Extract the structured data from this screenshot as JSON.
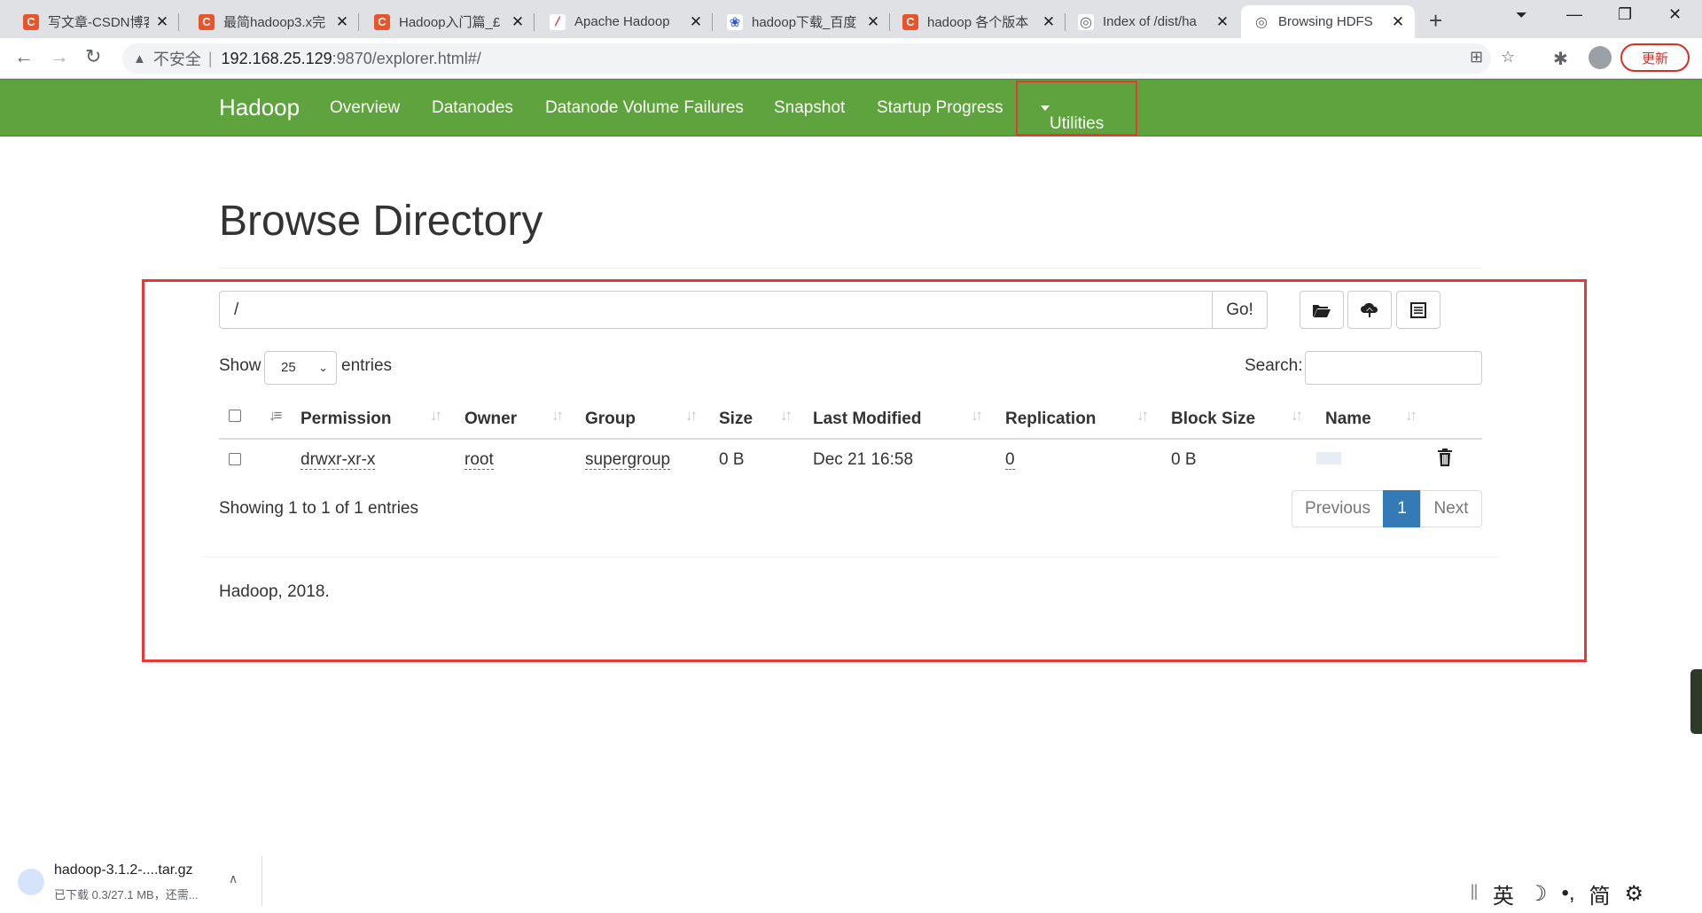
{
  "browser": {
    "tabs": [
      {
        "title": "写文章-CSDN博客",
        "icon": "csdn-icon"
      },
      {
        "title": "最简hadoop3.x完",
        "icon": "csdn-icon"
      },
      {
        "title": "Hadoop入门篇_£",
        "icon": "csdn-icon"
      },
      {
        "title": "Apache Hadoop",
        "icon": "apache-feather-icon"
      },
      {
        "title": "hadoop下载_百度",
        "icon": "baidu-paw-icon"
      },
      {
        "title": "hadoop 各个版本",
        "icon": "csdn-icon"
      },
      {
        "title": "Index of /dist/ha",
        "icon": "globe-icon"
      },
      {
        "title": "Browsing HDFS",
        "icon": "globe-icon"
      }
    ],
    "active_tab": 7,
    "address": {
      "security_label": "不安全",
      "host": "192.168.25.129",
      "path": ":9870/explorer.html#/"
    },
    "update_button": "更新"
  },
  "navbar": {
    "brand": "Hadoop",
    "items": [
      "Overview",
      "Datanodes",
      "Datanode Volume Failures",
      "Snapshot",
      "Startup Progress"
    ],
    "utilities": "Utilities"
  },
  "page": {
    "title": "Browse Directory",
    "path_value": "/",
    "go_label": "Go!",
    "show_label": "Show",
    "page_length": "25",
    "entries_label": "entries",
    "search_label": "Search:",
    "columns": [
      "Permission",
      "Owner",
      "Group",
      "Size",
      "Last Modified",
      "Replication",
      "Block Size",
      "Name"
    ],
    "rows": [
      {
        "permission": "drwxr-xr-x",
        "owner": "root",
        "group": "supergroup",
        "size": "0 B",
        "last_modified": "Dec 21 16:58",
        "replication": "0",
        "block_size": "0 B"
      }
    ],
    "info": "Showing 1 to 1 of 1 entries",
    "pagination": {
      "previous": "Previous",
      "current": "1",
      "next": "Next"
    },
    "footer": "Hadoop, 2018."
  },
  "downloads": {
    "file_name": "hadoop-3.1.2-....tar.gz",
    "status": "已下载 0.3/27.1 MB，还需..."
  },
  "ime": {
    "lang": "英",
    "moon": "☽",
    "punct": "•,",
    "script": "简"
  }
}
